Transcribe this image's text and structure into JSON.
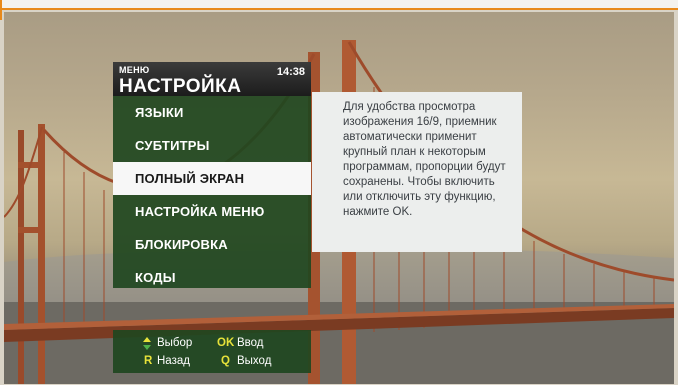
{
  "menu": {
    "small_label": "МЕНЮ",
    "title": "НАСТРОЙКА",
    "time": "14:38",
    "items": [
      {
        "label": "ЯЗЫКИ"
      },
      {
        "label": "СУБТИТРЫ"
      },
      {
        "label": "ПОЛНЫЙ ЭКРАН"
      },
      {
        "label": "НАСТРОЙКА МЕНЮ"
      },
      {
        "label": "БЛОКИРОВКА"
      },
      {
        "label": "КОДЫ"
      }
    ],
    "selected_index": 2
  },
  "info": {
    "text": "Для удобства просмотра изображения 16/9, приемник автоматически применит крупный план к некоторым программам, пропорции будут сохранены. Чтобы включить или отключить эту функцию, нажмите OK."
  },
  "help": {
    "select_icon": "up-down-arrows-icon",
    "select_label": "Выбор",
    "ok_key": "OK",
    "ok_label": "Ввод",
    "back_key": "R",
    "back_label": "Назад",
    "exit_key": "Q",
    "exit_label": "Выход"
  },
  "colors": {
    "menu_green": "#1f4620",
    "selected_bg": "#f7f7f7",
    "info_bg": "#eceeed",
    "key_yellow": "#e7e23a",
    "accent_orange": "#e8891a"
  }
}
